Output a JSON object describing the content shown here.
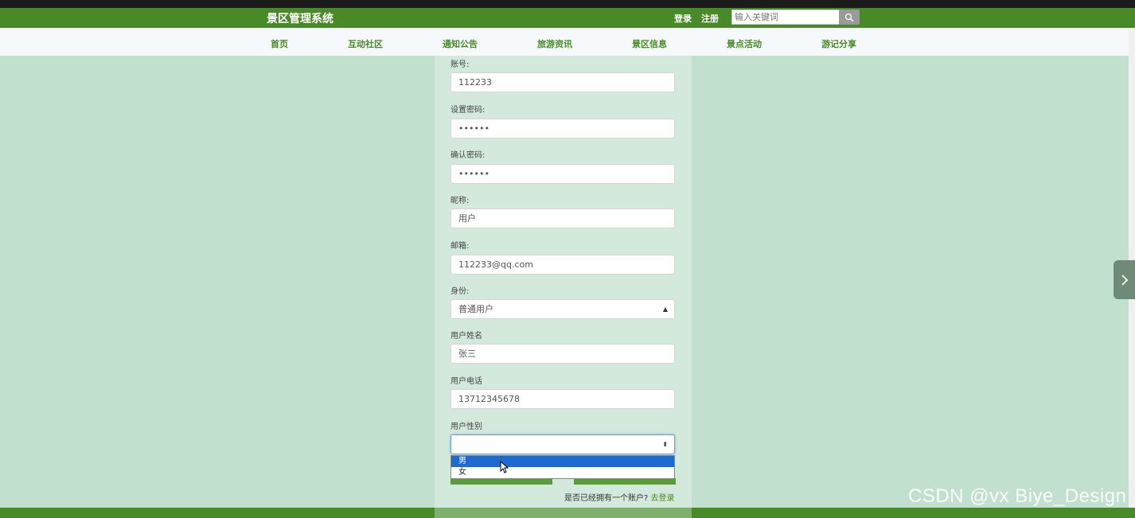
{
  "header": {
    "site_title": "景区管理系统",
    "login_label": "登录",
    "register_label": "注册",
    "search_placeholder": "输入关键词"
  },
  "nav": {
    "items": [
      "首页",
      "互动社区",
      "通知公告",
      "旅游资讯",
      "景区信息",
      "景点活动",
      "游记分享"
    ]
  },
  "form": {
    "account_label": "账号:",
    "account_value": "112233",
    "password_label": "设置密码:",
    "password_value": "••••••",
    "confirm_label": "确认密码:",
    "confirm_value": "••••••",
    "nickname_label": "昵称:",
    "nickname_value": "用户",
    "email_label": "邮箱:",
    "email_value": "112233@qq.com",
    "role_label": "身份:",
    "role_value": "普通用户",
    "name_label": "用户姓名",
    "name_value": "张三",
    "phone_label": "用户电话",
    "phone_value": "13712345678",
    "gender_label": "用户性别",
    "gender_value": "",
    "gender_options": [
      "男",
      "女"
    ],
    "has_account_text": "是否已经拥有一个账户?",
    "goto_login_label": "去登录"
  },
  "watermark": "CSDN @vx Biye_Design",
  "colors": {
    "brand_green": "#488a27",
    "page_bg": "#c1e1ce",
    "panel_bg": "#d3e9dc",
    "selected_option": "#1e6ad3"
  }
}
